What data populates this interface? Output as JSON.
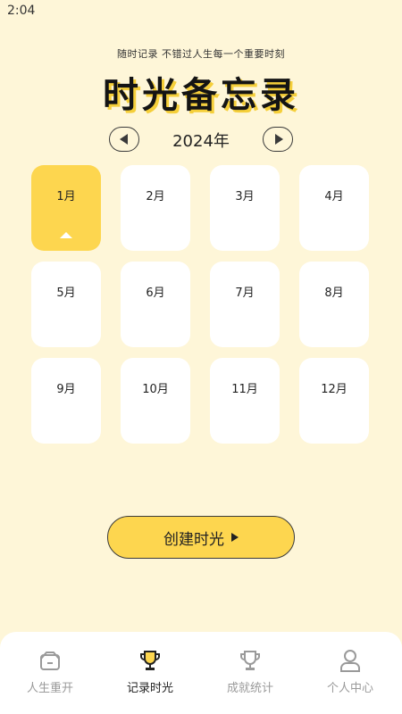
{
  "status_bar": {
    "time": "2:04"
  },
  "header": {
    "subtitle": "随时记录 不错过人生每一个重要时刻",
    "title": "时光备忘录"
  },
  "year_selector": {
    "year_label": "2024年",
    "prev_icon": "chevron-left-icon",
    "next_icon": "chevron-right-icon"
  },
  "months": [
    {
      "label": "1月",
      "selected": true
    },
    {
      "label": "2月",
      "selected": false
    },
    {
      "label": "3月",
      "selected": false
    },
    {
      "label": "4月",
      "selected": false
    },
    {
      "label": "5月",
      "selected": false
    },
    {
      "label": "6月",
      "selected": false
    },
    {
      "label": "7月",
      "selected": false
    },
    {
      "label": "8月",
      "selected": false
    },
    {
      "label": "9月",
      "selected": false
    },
    {
      "label": "10月",
      "selected": false
    },
    {
      "label": "11月",
      "selected": false
    },
    {
      "label": "12月",
      "selected": false
    }
  ],
  "create_button": {
    "label": "创建时光",
    "icon": "play-icon"
  },
  "bottom_nav": {
    "items": [
      {
        "label": "人生重开",
        "icon": "box-icon",
        "active": false
      },
      {
        "label": "记录时光",
        "icon": "trophy-icon",
        "active": true
      },
      {
        "label": "成就统计",
        "icon": "trophy-icon",
        "active": false
      },
      {
        "label": "个人中心",
        "icon": "person-icon",
        "active": false
      }
    ]
  },
  "colors": {
    "background": "#fef6d8",
    "accent": "#fdd64f",
    "card": "#ffffff",
    "text": "#222222",
    "inactive_text": "#9a9a9a"
  }
}
